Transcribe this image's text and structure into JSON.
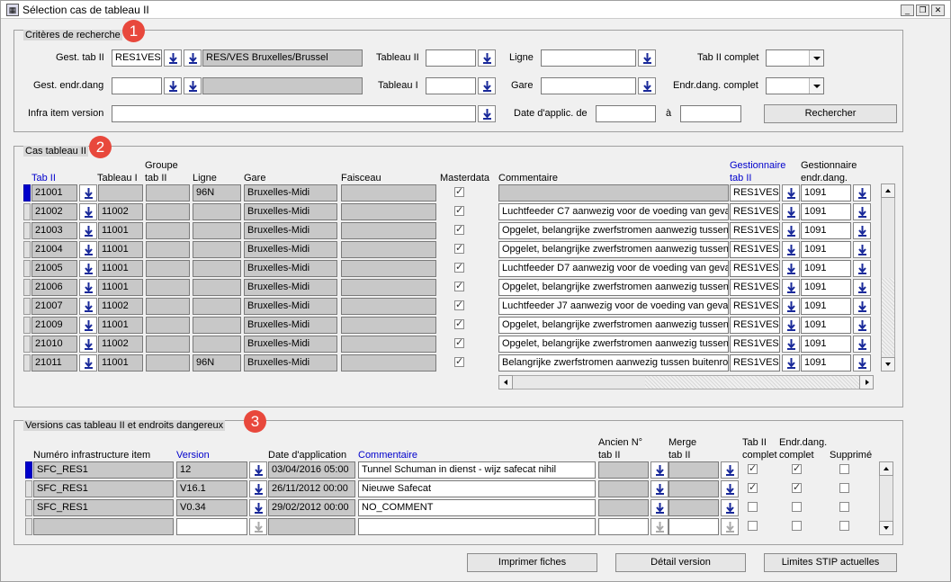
{
  "window": {
    "title": "Sélection cas de tableau II"
  },
  "badges": [
    "1",
    "2",
    "3"
  ],
  "criteria": {
    "legend": "Critères de recherche",
    "gest_tab_label": "Gest. tab II",
    "gest_tab_code": "RES1VES",
    "gest_tab_name": "RES/VES Bruxelles/Brussel",
    "gest_endr_label": "Gest. endr.dang",
    "tableau2_label": "Tableau II",
    "tableau1_label": "Tableau I",
    "ligne_label": "Ligne",
    "gare_label": "Gare",
    "tab_complet_label": "Tab II complet",
    "endr_complet_label": "Endr.dang. complet",
    "infra_label": "Infra item version",
    "date_label": "Date d'applic. de",
    "a_label": "à",
    "search_button": "Rechercher"
  },
  "cases": {
    "legend": "Cas tableau II",
    "headers": {
      "tab": "Tab II",
      "tableau1": "Tableau I",
      "groupe1": "Groupe",
      "groupe2": "tab II",
      "ligne": "Ligne",
      "gare": "Gare",
      "faisceau": "Faisceau",
      "masterdata": "Masterdata",
      "commentaire": "Commentaire",
      "gest1": "Gestionnaire",
      "gest2": "tab II",
      "gest_endr1": "Gestionnaire",
      "gest_endr2": "endr.dang."
    },
    "rows": [
      {
        "tab": "21001",
        "tableau1": "",
        "ligne": "96N",
        "gare": "Bruxelles-Midi",
        "comment": "",
        "gest": "RES1VES",
        "gest_endr": "1091"
      },
      {
        "tab": "21002",
        "tableau1": "11002",
        "ligne": "",
        "gare": "Bruxelles-Midi",
        "comment": "Luchtfeeder C7 aanwezig voor de voeding van geva",
        "gest": "RES1VES",
        "gest_endr": "1091"
      },
      {
        "tab": "21003",
        "tableau1": "11001",
        "ligne": "",
        "gare": "Bruxelles-Midi",
        "comment": "Opgelet, belangrijke zwerfstromen aanwezig tussen",
        "gest": "RES1VES",
        "gest_endr": "1091"
      },
      {
        "tab": "21004",
        "tableau1": "11001",
        "ligne": "",
        "gare": "Bruxelles-Midi",
        "comment": "Opgelet, belangrijke zwerfstromen aanwezig tussen",
        "gest": "RES1VES",
        "gest_endr": "1091"
      },
      {
        "tab": "21005",
        "tableau1": "11001",
        "ligne": "",
        "gare": "Bruxelles-Midi",
        "comment": "Luchtfeeder D7 aanwezig voor de voeding van geva",
        "gest": "RES1VES",
        "gest_endr": "1091"
      },
      {
        "tab": "21006",
        "tableau1": "11001",
        "ligne": "",
        "gare": "Bruxelles-Midi",
        "comment": "Opgelet, belangrijke zwerfstromen aanwezig tussen",
        "gest": "RES1VES",
        "gest_endr": "1091"
      },
      {
        "tab": "21007",
        "tableau1": "11002",
        "ligne": "",
        "gare": "Bruxelles-Midi",
        "comment": "Luchtfeeder J7 aanwezig voor de voeding van geva",
        "gest": "RES1VES",
        "gest_endr": "1091"
      },
      {
        "tab": "21009",
        "tableau1": "11001",
        "ligne": "",
        "gare": "Bruxelles-Midi",
        "comment": "Opgelet, belangrijke zwerfstromen aanwezig tussen",
        "gest": "RES1VES",
        "gest_endr": "1091"
      },
      {
        "tab": "21010",
        "tableau1": "11002",
        "ligne": "",
        "gare": "Bruxelles-Midi",
        "comment": "Opgelet, belangrijke zwerfstromen aanwezig tussen",
        "gest": "RES1VES",
        "gest_endr": "1091"
      },
      {
        "tab": "21011",
        "tableau1": "11001",
        "ligne": "96N",
        "gare": "Bruxelles-Midi",
        "comment": "Belangrijke zwerfstromen aanwezig tussen buitenro",
        "gest": "RES1VES",
        "gest_endr": "1091"
      }
    ]
  },
  "versions": {
    "legend": "Versions cas tableau II et endroits dangereux",
    "headers": {
      "infra": "Numéro infrastructure item",
      "version": "Version",
      "date": "Date d'application",
      "commentaire": "Commentaire",
      "ancien1": "Ancien N°",
      "ancien2": "tab II",
      "merge1": "Merge",
      "merge2": "tab II",
      "tabc1": "Tab II",
      "tabc2": "complet",
      "endrc1": "Endr.dang.",
      "endrc2": "complet",
      "supprime": "Supprimé"
    },
    "rows": [
      {
        "infra": "SFC_RES1",
        "version": "12",
        "date": "03/04/2016 05:00",
        "comment": "Tunnel Schuman in dienst - wijz safecat nihil",
        "tabc": true,
        "endrc": true,
        "supp": false
      },
      {
        "infra": "SFC_RES1",
        "version": "V16.1",
        "date": "26/11/2012 00:00",
        "comment": "Nieuwe Safecat",
        "tabc": true,
        "endrc": true,
        "supp": false
      },
      {
        "infra": "SFC_RES1",
        "version": "V0.34",
        "date": "29/02/2012 00:00",
        "comment": "NO_COMMENT",
        "tabc": false,
        "endrc": false,
        "supp": false
      },
      {
        "infra": "",
        "version": "",
        "date": "",
        "comment": "",
        "tabc": false,
        "endrc": false,
        "supp": false
      }
    ]
  },
  "footer": {
    "print_button": "Imprimer fiches",
    "detail_button": "Détail version",
    "limits_button": "Limites STIP actuelles"
  },
  "colors": {
    "badge": "#e8483c",
    "link": "#0000cc",
    "readonly": "#c8c8c8"
  }
}
